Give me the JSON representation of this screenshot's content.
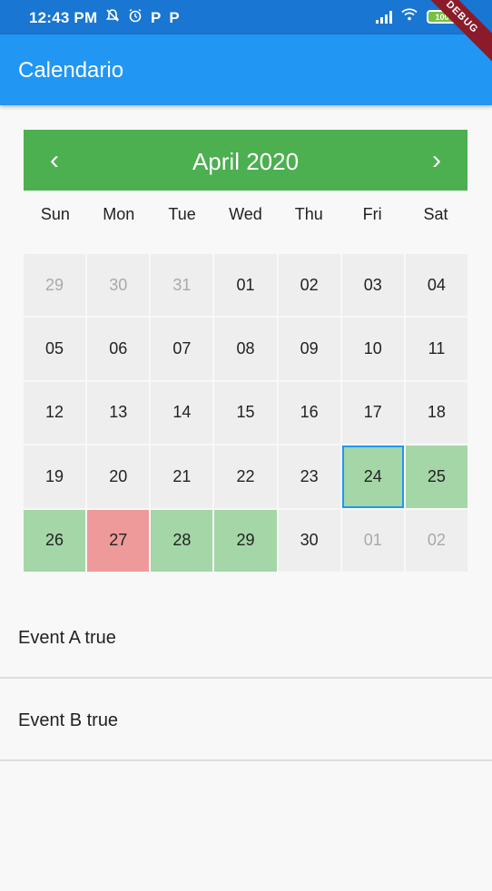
{
  "status_bar": {
    "time": "12:43 PM",
    "left_icons": [
      "bell-off-icon",
      "alarm-icon",
      "p-icon",
      "p-icon"
    ],
    "battery": "100"
  },
  "debug_banner": "DEBUG",
  "app_bar": {
    "title": "Calendario"
  },
  "calendar": {
    "month_title": "April 2020",
    "prev_icon": "‹",
    "next_icon": "›",
    "weekdays": [
      "Sun",
      "Mon",
      "Tue",
      "Wed",
      "Thu",
      "Fri",
      "Sat"
    ],
    "weeks": [
      [
        {
          "d": "29",
          "muted": true
        },
        {
          "d": "30",
          "muted": true
        },
        {
          "d": "31",
          "muted": true
        },
        {
          "d": "01"
        },
        {
          "d": "02"
        },
        {
          "d": "03"
        },
        {
          "d": "04"
        }
      ],
      [
        {
          "d": "05"
        },
        {
          "d": "06"
        },
        {
          "d": "07"
        },
        {
          "d": "08"
        },
        {
          "d": "09"
        },
        {
          "d": "10"
        },
        {
          "d": "11"
        }
      ],
      [
        {
          "d": "12"
        },
        {
          "d": "13"
        },
        {
          "d": "14"
        },
        {
          "d": "15"
        },
        {
          "d": "16"
        },
        {
          "d": "17"
        },
        {
          "d": "18"
        }
      ],
      [
        {
          "d": "19"
        },
        {
          "d": "20"
        },
        {
          "d": "21"
        },
        {
          "d": "22"
        },
        {
          "d": "23"
        },
        {
          "d": "24",
          "mark": "green",
          "selected": true
        },
        {
          "d": "25",
          "mark": "green"
        }
      ],
      [
        {
          "d": "26",
          "mark": "green"
        },
        {
          "d": "27",
          "mark": "red"
        },
        {
          "d": "28",
          "mark": "green"
        },
        {
          "d": "29",
          "mark": "green"
        },
        {
          "d": "30"
        },
        {
          "d": "01",
          "muted": true
        },
        {
          "d": "02",
          "muted": true
        }
      ]
    ]
  },
  "events": [
    "Event A true",
    "Event B true"
  ],
  "colors": {
    "status_bar": "#1976d2",
    "app_bar": "#2196f3",
    "calendar_header": "#4caf50",
    "event_green": "#a5d6a7",
    "event_red": "#ef9a9a",
    "selected_border": "#2196f3"
  }
}
